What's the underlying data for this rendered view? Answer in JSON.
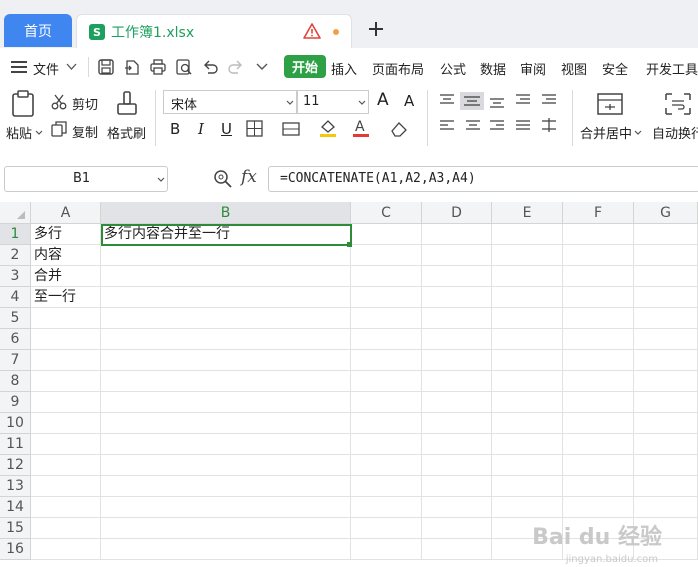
{
  "tabs": {
    "home": "首页",
    "file_badge": "S",
    "file_name": "工作簿1.xlsx"
  },
  "menu": {
    "file": "文件",
    "items": [
      "开始",
      "插入",
      "页面布局",
      "公式",
      "数据",
      "审阅",
      "视图",
      "安全",
      "开发工具"
    ]
  },
  "ribbon": {
    "paste": "粘贴",
    "cut": "剪切",
    "copy": "复制",
    "format_painter": "格式刷",
    "font_name": "宋体",
    "font_size": "11",
    "merge_center": "合并居中",
    "auto_wrap": "自动换行",
    "bold": "B",
    "italic": "I",
    "underline": "U",
    "font_color_letter": "A",
    "increase_font": "A",
    "decrease_font": "A"
  },
  "formula_bar": {
    "name_box": "B1",
    "fx_label": "fx",
    "formula": "=CONCATENATE(A1,A2,A3,A4)"
  },
  "sheet": {
    "columns": [
      "A",
      "B",
      "C",
      "D",
      "E",
      "F",
      "G"
    ],
    "rows": [
      "1",
      "2",
      "3",
      "4",
      "5",
      "6",
      "7",
      "8",
      "9",
      "10",
      "11",
      "12",
      "13",
      "14",
      "15",
      "16"
    ],
    "cells": {
      "A1": "多行",
      "A2": "内容",
      "A3": "合并",
      "A4": "至一行",
      "B1": "多行内容合并至一行"
    },
    "selected_cell": "B1"
  },
  "watermark": {
    "brand": "Bai du 经验",
    "url": "jingyan.baidu.com"
  },
  "colors": {
    "accent_green": "#2ea046",
    "home_tab_blue": "#3f86f0",
    "file_green": "#1d9f5e"
  }
}
